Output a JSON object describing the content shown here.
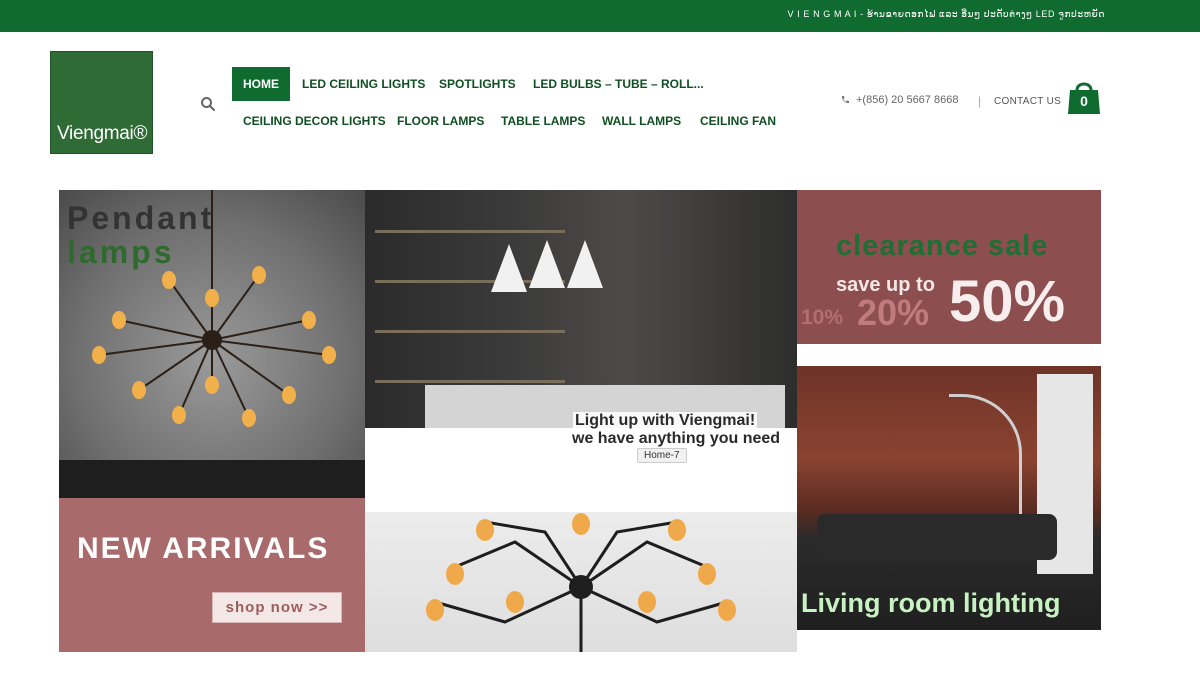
{
  "top_bar": {
    "text": "V I E N G M A I - ຮ້ານຂາຍດອກໄຟ ແລະ ອື່ນໆ ປະດັບຕ່າງໆ LED ຈູກປະຫຍັດ"
  },
  "logo": {
    "text": "Viengmai®"
  },
  "nav": {
    "row1": [
      "HOME",
      "LED CEILING LIGHTS",
      "SPOTLIGHTS",
      "LED BULBS – TUBE – ROLL..."
    ],
    "row2": [
      "CEILING DECOR LIGHTS",
      "FLOOR LAMPS",
      "TABLE LAMPS",
      "WALL LAMPS",
      "CEILING FAN"
    ],
    "active": "HOME"
  },
  "contact": {
    "phone": "+(856) 20 5667 8668",
    "divider": "|",
    "contact_us": "CONTACT US"
  },
  "cart": {
    "count": "0"
  },
  "banners": {
    "pendant": {
      "line1": "Pendant",
      "line2": "lamps"
    },
    "interior": {
      "caption1": "Light up with Viengmai!",
      "caption2": "we have anything you need",
      "tag": "Home-7"
    },
    "clearance": {
      "title": "clearance sale",
      "save": "save up to",
      "pct10": "10%",
      "pct20": "20%",
      "pct50": "50%"
    },
    "new_arrivals": {
      "title": "NEW ARRIVALS",
      "button": "shop now >>"
    },
    "living": {
      "text": "Living room lighting"
    }
  },
  "colors": {
    "brand_green": "#0f6b2f",
    "rose": "#a96a6b",
    "clearance_bg": "#8d4e4f"
  }
}
